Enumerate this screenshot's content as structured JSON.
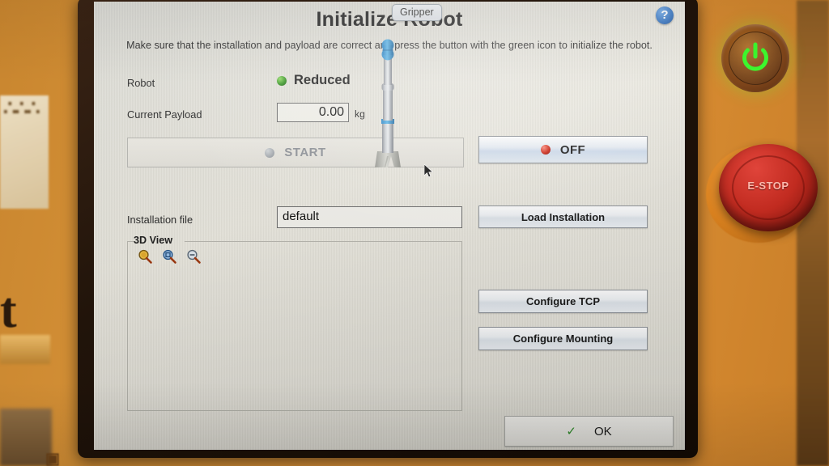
{
  "window": {
    "title": "Initialize Robot",
    "subtitle": "Make sure that the installation and payload are correct and press the button with the green icon to initialize the robot.",
    "help_icon_glyph": "?",
    "help_icon_name": "help-icon",
    "overlay_chip": "Gripper"
  },
  "status": {
    "robot_label": "Robot",
    "robot_state": "Reduced",
    "robot_state_color": "#2f8f1e",
    "payload_label": "Current Payload",
    "payload_value": "0.00",
    "payload_unit": "kg"
  },
  "actions": {
    "start_label": "START",
    "start_enabled": false,
    "off_label": "OFF",
    "off_indicator_color": "#cc2211",
    "load_installation_label": "Load Installation",
    "configure_tcp_label": "Configure TCP",
    "configure_mounting_label": "Configure Mounting",
    "ok_label": "OK",
    "ok_check_glyph": "✓",
    "ok_check_color": "#2f8f2a"
  },
  "installation": {
    "label": "Installation file",
    "value": "default"
  },
  "view3d": {
    "group_title": "3D View",
    "tools": [
      {
        "name": "zoom-in-icon",
        "title": "Zoom In"
      },
      {
        "name": "zoom-fit-icon",
        "title": "Zoom Fit"
      },
      {
        "name": "zoom-out-icon",
        "title": "Zoom Out"
      }
    ],
    "model": "robot-arm-upright"
  },
  "hardware": {
    "power_button_label": "power-on",
    "power_button_color": "#3dfa2e",
    "estop_label": "E-STOP",
    "estop_color": "#c12b20"
  },
  "background": {
    "sign_text": "∴∴∴",
    "big_letter": "t",
    "corner_mark": "▣"
  }
}
